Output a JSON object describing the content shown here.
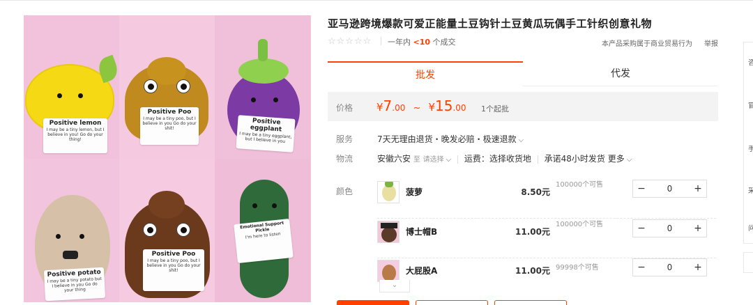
{
  "product": {
    "title": "亚马逊跨境爆款可爱正能量土豆钩针土豆黄瓜玩偶手工针织创意礼物",
    "stars": "☆☆☆☆☆",
    "sales_prefix": "一年内",
    "sales_count": "<10",
    "sales_suffix": "个成交",
    "statement": "本产品采购属于商业贸易行为",
    "report": "举报"
  },
  "gallery": {
    "cards": [
      {
        "title": "Positive lemon",
        "body": "I may be a tiny lemon, but I believe in you! Go do your thing!"
      },
      {
        "title": "Positive Poo",
        "body": "I may be a tiny poo, but I believe in you Go do your shit!"
      },
      {
        "title": "Positive eggplant",
        "body": "I may be a tiny eggplant, but I believe in you"
      },
      {
        "title": "Positive potato",
        "body": "I may be a tiny potato but I believe in you Go do your thing"
      },
      {
        "title": "Positive Poo",
        "body": "I may be a tiny poo, but I believe in you Go do your shit!"
      },
      {
        "title": "Emotional Support Pickle",
        "body": "I'm here to listen"
      }
    ],
    "more_icon": "chevron-down-icon"
  },
  "tabs": [
    {
      "label": "批发",
      "active": true
    },
    {
      "label": "代发",
      "active": false
    }
  ],
  "price": {
    "label": "价格",
    "low_currency": "¥",
    "low_int": "7",
    "low_dec": ".00",
    "tilde": "~",
    "high_currency": "¥",
    "high_int": "15",
    "high_dec": ".00",
    "moq": "1个起批",
    "accent": "#ff4000"
  },
  "service": {
    "label": "服务",
    "text": "7天无理由退货・晚发必赔・极速退款"
  },
  "logistics": {
    "label": "物流",
    "origin": "安徽六安",
    "to": "至",
    "select": "请选择",
    "fee": "运费：选择收货地",
    "promise": "承诺48小时发货",
    "more": "更多"
  },
  "color": {
    "label": "颜色",
    "skus": [
      {
        "name": "菠萝",
        "price": "8.50元",
        "stock": "100000个可售",
        "qty": "0"
      },
      {
        "name": "博士帽B",
        "price": "11.00元",
        "stock": "100000个可售",
        "qty": "0"
      },
      {
        "name": "大屁股A",
        "price": "11.00元",
        "stock": "99998个可售",
        "qty": "0"
      }
    ],
    "minus": "−",
    "plus": "+"
  },
  "sidebar": {
    "items": [
      "咨",
      "官",
      "手",
      "采",
      "问"
    ]
  }
}
